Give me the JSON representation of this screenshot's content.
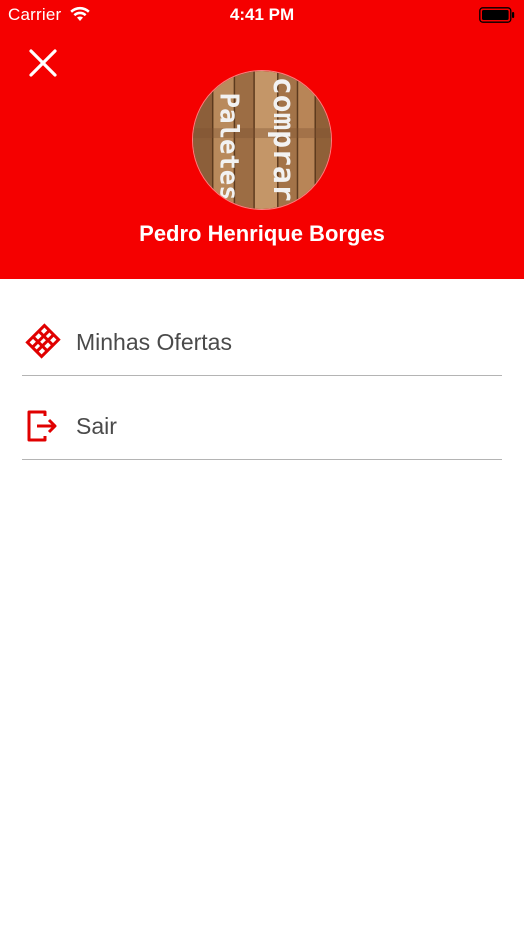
{
  "status_bar": {
    "carrier": "Carrier",
    "time": "4:41 PM",
    "wifi_icon": "wifi-icon",
    "battery_icon": "battery-icon"
  },
  "header": {
    "close_icon": "close-icon",
    "avatar_text_1": "comprar",
    "avatar_text_2": "Paletes",
    "user_name": "Pedro Henrique Borges",
    "background_color": "#f50000"
  },
  "menu": {
    "items": [
      {
        "label": "Minhas Ofertas",
        "icon": "pallet-icon"
      },
      {
        "label": "Sair",
        "icon": "logout-icon"
      }
    ],
    "icon_color": "#e00000",
    "divider_color": "#b4b4b4"
  }
}
